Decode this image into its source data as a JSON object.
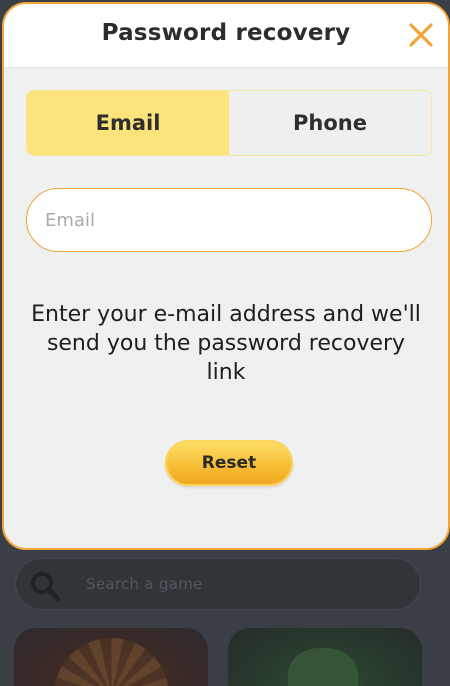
{
  "modal": {
    "title": "Password recovery",
    "tabs": [
      {
        "label": "Email",
        "active": true
      },
      {
        "label": "Phone",
        "active": false
      }
    ],
    "email_input": {
      "placeholder": "Email",
      "value": ""
    },
    "instructions": "Enter your e-mail address and we'll send you the password recovery link",
    "reset_label": "Reset",
    "icons": {
      "close": "close-icon"
    }
  },
  "background": {
    "search_placeholder": "Search a game",
    "icons": {
      "search": "search-icon"
    }
  },
  "colors": {
    "accent": "#f0a43a",
    "tab_active": "#fde47a",
    "button_top": "#fde06a",
    "button_bottom": "#f0a520"
  }
}
